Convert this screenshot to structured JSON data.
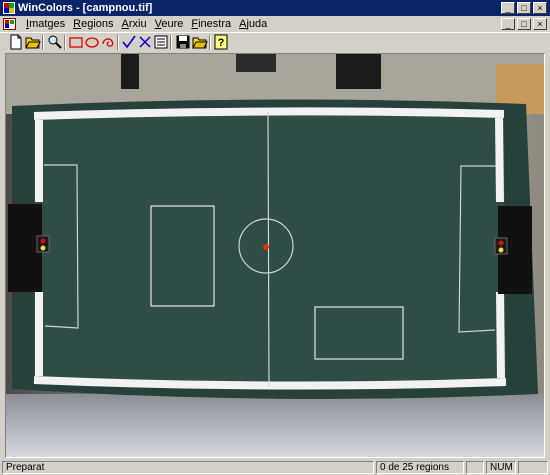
{
  "window": {
    "title": "WinColors - [campnou.tif]",
    "controls": {
      "minimize": "_",
      "maximize": "□",
      "close": "×"
    }
  },
  "menu": {
    "items": [
      {
        "label": "Imatges",
        "key": "I"
      },
      {
        "label": "Regions",
        "key": "R"
      },
      {
        "label": "Arxiu",
        "key": "A"
      },
      {
        "label": "Veure",
        "key": "V"
      },
      {
        "label": "Finestra",
        "key": "F"
      },
      {
        "label": "Ajuda",
        "key": "A"
      }
    ]
  },
  "toolbar": {
    "buttons": [
      "new-icon",
      "open-icon",
      "zoom-icon",
      "rect-select-icon",
      "ellipse-select-icon",
      "freehand-select-icon",
      "check-icon",
      "cross-icon",
      "region-list-icon",
      "save-icon",
      "open-folder-icon",
      "help-icon"
    ]
  },
  "status": {
    "left": "Preparat",
    "regions": "0 de 25 regions",
    "num": "NUM"
  },
  "colors": {
    "titlebar": "#0a246a",
    "field": "#2e4a45",
    "lines": "#e8e8e8",
    "selection": "#e6e6e6"
  }
}
